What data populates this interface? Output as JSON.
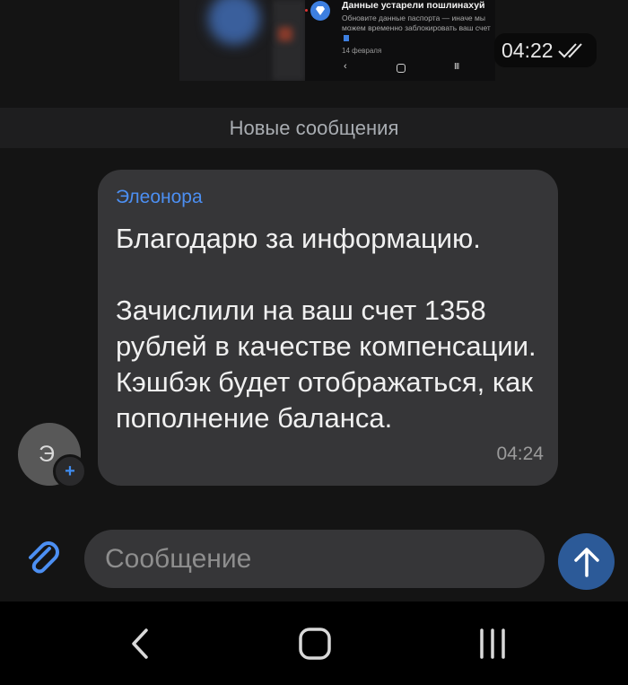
{
  "previous_message": {
    "screenshot": {
      "title": "Данные устарели пошлинахуй",
      "body": "Обновите данные паспорта — иначе мы можем временно заблокировать ваш счет",
      "date": "14 февраля",
      "nav_back": "‹",
      "nav_recent": "III"
    },
    "time": "04:22",
    "status": "read"
  },
  "divider": {
    "label": "Новые сообщения"
  },
  "message": {
    "avatar_letter": "Э",
    "avatar_badge": "+",
    "sender": "Элеонора",
    "text": "Благодарю за информацию.\n\nЗачислили на ваш счет 1358 рублей в качестве компенсации. Кэшбэк будет отображаться, как пополнение баланса.",
    "time": "04:24"
  },
  "compose": {
    "placeholder": "Сообщение",
    "value": ""
  },
  "icons": {
    "attach": "paperclip-icon",
    "send": "arrow-up-icon",
    "back": "back-icon",
    "home": "home-icon",
    "recent": "recent-apps-icon"
  },
  "colors": {
    "accent": "#4c8ff2",
    "send_button": "#2c5a98",
    "bubble": "#363638",
    "background": "#141414"
  }
}
